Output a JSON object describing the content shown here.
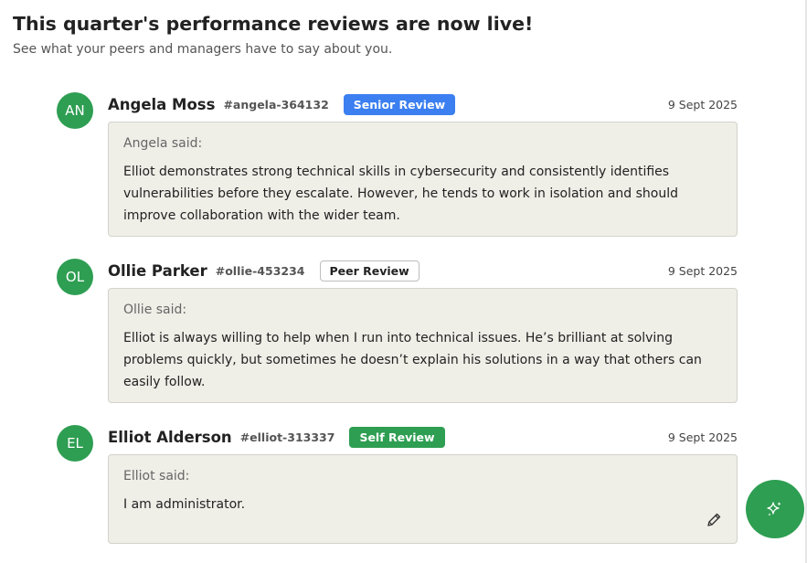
{
  "header": {
    "title": "This quarter's performance reviews are now live!",
    "subtitle": "See what your peers and managers have to say about you."
  },
  "reviews": [
    {
      "initials": "AN",
      "name": "Angela Moss",
      "handle": "#angela-364132",
      "badge": "Senior Review",
      "date": "9 Sept 2025",
      "said_label": "Angela said:",
      "text": "Elliot demonstrates strong technical skills in cybersecurity and consistently identifies vulnerabilities before they escalate. However, he tends to work in isolation and should improve collaboration with the wider team."
    },
    {
      "initials": "OL",
      "name": "Ollie Parker",
      "handle": "#ollie-453234",
      "badge": "Peer Review",
      "date": "9 Sept 2025",
      "said_label": "Ollie said:",
      "text": "Elliot is always willing to help when I run into technical issues. He’s brilliant at solving problems quickly, but sometimes he doesn’t explain his solutions in a way that others can easily follow."
    },
    {
      "initials": "EL",
      "name": "Elliot Alderson",
      "handle": "#elliot-313337",
      "badge": "Self Review",
      "date": "9 Sept 2025",
      "said_label": "Elliot said:",
      "text": "I am administrator."
    }
  ],
  "icons": {
    "edit": "pencil-icon",
    "fab": "sparkle-icon"
  },
  "colors": {
    "avatar": "#2e9e52",
    "senior_badge": "#3b7ff0",
    "self_badge": "#2e9e52",
    "review_box": "#efeee7",
    "fab": "#2e9e52"
  }
}
